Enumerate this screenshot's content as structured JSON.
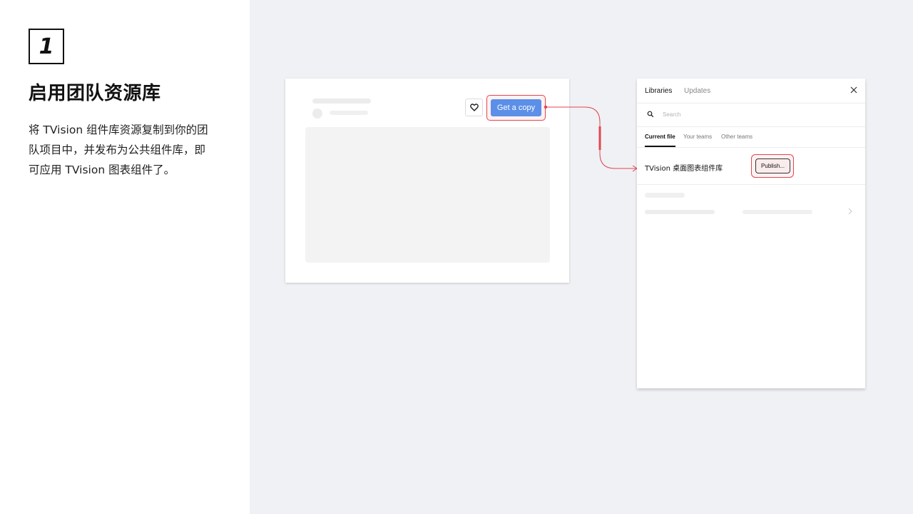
{
  "step": {
    "number": "1",
    "title": "启用团队资源库",
    "description": "将 TVision 组件库资源复制到你的团队项目中，并发布为公共组件库，即可应用 TVision 图表组件了。"
  },
  "file_card": {
    "copy_button_label": "Get a copy"
  },
  "libraries_panel": {
    "tabs": [
      {
        "label": "Libraries",
        "active": true
      },
      {
        "label": "Updates",
        "active": false
      }
    ],
    "search_placeholder": "Search",
    "sub_tabs": [
      {
        "label": "Current file",
        "active": true
      },
      {
        "label": "Your teams",
        "active": false
      },
      {
        "label": "Other teams",
        "active": false
      }
    ],
    "library_name": "TVision 桌面图表组件库",
    "publish_label": "Publish..."
  },
  "colors": {
    "accent_blue": "#5b8fe8",
    "highlight_red": "#e0474f",
    "background": "#f0f1f5"
  }
}
